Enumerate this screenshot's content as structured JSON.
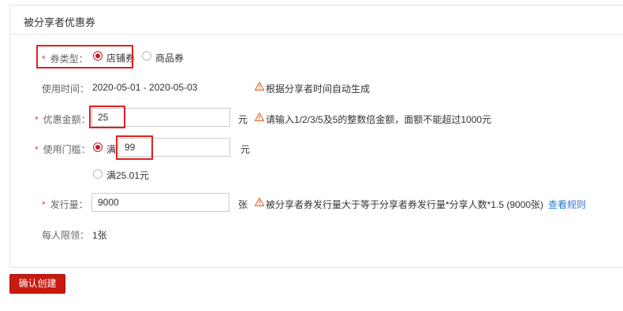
{
  "panel": {
    "title": "被分享者优惠券"
  },
  "coupon_type": {
    "required_mark": "*",
    "label": "券类型：",
    "options": [
      {
        "label": "店铺券",
        "selected": true
      },
      {
        "label": "商品券",
        "selected": false
      }
    ]
  },
  "use_time": {
    "label": "使用时间：",
    "value": "2020-05-01 - 2020-05-03",
    "tip": "根据分享者时间自动生成"
  },
  "discount": {
    "required_mark": "*",
    "label": "优惠金额：",
    "value": "25",
    "unit": "元",
    "tip": "请输入1/2/3/5及5的整数倍金额，面额不能超过1000元"
  },
  "threshold": {
    "required_mark": "*",
    "label": "使用门槛：",
    "option1_prefix": "满",
    "option1_value": "99",
    "unit": "元",
    "option2_label": "满25.01元",
    "option1_selected": true
  },
  "issue_qty": {
    "required_mark": "*",
    "label": "发行量：",
    "value": "9000",
    "unit": "张",
    "tip": "被分享者券发行量大于等于分享者券发行量*分享人数*1.5 (9000张)",
    "link": "查看规则"
  },
  "limit": {
    "label": "每人限领：",
    "value": "1张"
  },
  "submit_label": "确认创建",
  "colors": {
    "accent": "#c81623",
    "warning": "#e8712c",
    "link": "#2b78d0",
    "highlight": "#e02020"
  }
}
